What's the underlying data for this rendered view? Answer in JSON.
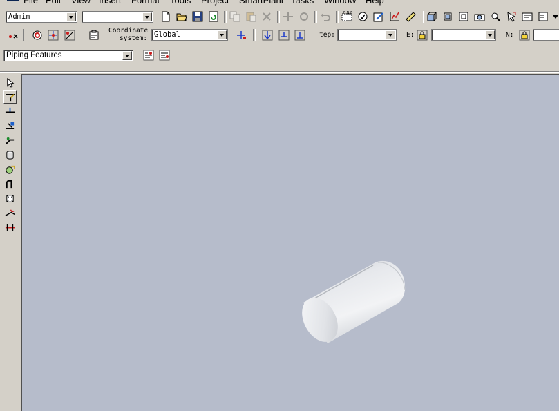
{
  "menu": {
    "items": [
      "File",
      "Edit",
      "View",
      "Insert",
      "Format",
      "Tools",
      "Project",
      "SmartPlant",
      "Tasks",
      "Window",
      "Help"
    ]
  },
  "toolbar1": {
    "permission_group": "Admin",
    "filter_combo": "",
    "icons": [
      "new-icon",
      "open-icon",
      "save-icon",
      "refresh-icon",
      "copy-icon",
      "paste-icon",
      "delete-icon",
      "move-icon",
      "rotate-icon",
      "undo-icon",
      "measure-icon",
      "check-icon",
      "edit-icon",
      "chart-icon",
      "ruler-icon",
      "view-icon",
      "view2-icon",
      "view3-icon",
      "camera-icon",
      "zoom-icon",
      "select-icon",
      "properties-icon",
      "more-icon"
    ]
  },
  "toolbar2": {
    "coordinate_label_line1": "Coordinate",
    "coordinate_label_line2": "system:",
    "coordinate_system": "Global",
    "step_label": "tep:",
    "step_value": "",
    "e_label": "E:",
    "e_value": "",
    "n_label": "N:"
  },
  "toolbar3": {
    "feature_type": "Piping Features"
  },
  "left_toolbar": {
    "icons": [
      "select-arrow-icon",
      "route-icon",
      "insert-split-icon",
      "place-component-icon",
      "place-turn-icon",
      "place-nozzle-icon",
      "place-valve-icon",
      "route-bend-icon",
      "place-part-icon",
      "connect-icon",
      "insert-flange-icon"
    ]
  },
  "viewport": {
    "background": "#b6bccb",
    "object": "pipe-cylinder"
  }
}
